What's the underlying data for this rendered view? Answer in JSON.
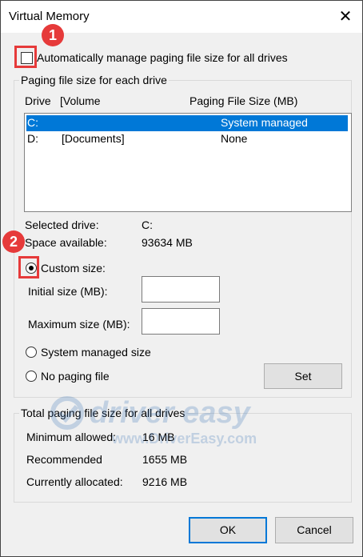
{
  "window": {
    "title": "Virtual Memory",
    "close_glyph": "✕"
  },
  "auto_manage": {
    "label": "Automatically manage paging file size for all drives",
    "checked": false
  },
  "paging_group": {
    "title": "Paging file size for each drive",
    "columns": [
      "Drive",
      "[Volume",
      "Paging File Size (MB)"
    ],
    "rows": [
      {
        "drive": "C:",
        "volume": "",
        "size": "System managed",
        "selected": true
      },
      {
        "drive": "D:",
        "volume": "[Documents]",
        "size": "None",
        "selected": false
      }
    ],
    "selected_drive_label": "Selected drive:",
    "selected_drive_value": "C:",
    "space_label": "Space available:",
    "space_value": "93634 MB",
    "custom_size_label": "Custom size:",
    "initial_label": "Initial size (MB):",
    "initial_value": "",
    "maximum_label": "Maximum size (MB):",
    "maximum_value": "",
    "system_managed_label": "System managed size",
    "no_paging_label": "No paging file",
    "selected_option": "custom",
    "set_label": "Set"
  },
  "total_group": {
    "title": "Total paging file size for all drives",
    "minimum_label": "Minimum allowed:",
    "minimum_value": "16 MB",
    "recommended_label": "Recommended",
    "recommended_value": "1655 MB",
    "allocated_label": "Currently allocated:",
    "allocated_value": "9216 MB"
  },
  "buttons": {
    "ok": "OK",
    "cancel": "Cancel"
  },
  "callouts": {
    "step1": "1",
    "step2": "2"
  },
  "watermark": {
    "brand": "driver easy",
    "url": "www.DriverEasy.com"
  },
  "colors": {
    "accent": "#0078d7",
    "callout": "#e63a3a",
    "background": "#f0f0f0"
  }
}
